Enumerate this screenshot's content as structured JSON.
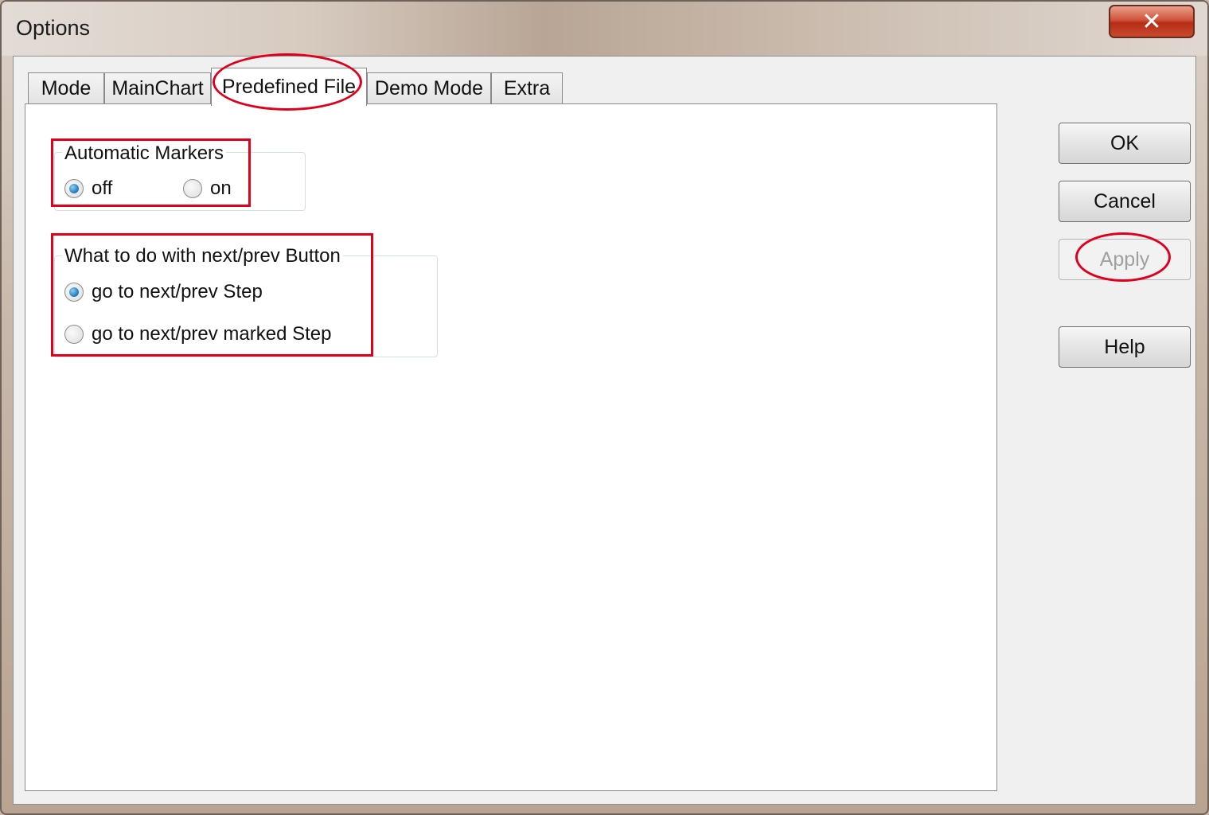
{
  "window": {
    "title": "Options",
    "close_glyph": "✕"
  },
  "tabs": [
    {
      "label": "Mode"
    },
    {
      "label": "MainChart"
    },
    {
      "label": "Predefined File",
      "active": true
    },
    {
      "label": "Demo Mode"
    },
    {
      "label": "Extra"
    }
  ],
  "automatic_markers": {
    "title": "Automatic Markers",
    "options": [
      {
        "label": "off",
        "checked": true
      },
      {
        "label": "on",
        "checked": false
      }
    ]
  },
  "next_prev": {
    "title": "What to do with next/prev  Button",
    "options": [
      {
        "label": "go to next/prev Step",
        "checked": true
      },
      {
        "label": "go to next/prev marked Step",
        "checked": false
      }
    ]
  },
  "buttons": {
    "ok": "OK",
    "cancel": "Cancel",
    "apply": "Apply",
    "help": "Help"
  },
  "annotation_color": "#e0001b"
}
